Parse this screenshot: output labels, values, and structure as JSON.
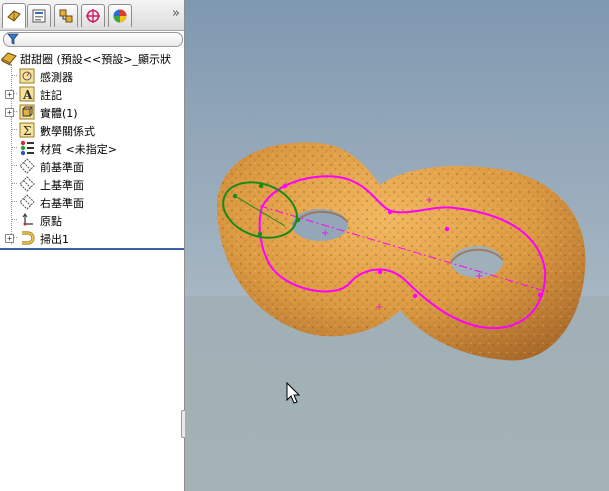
{
  "feature_tree": {
    "tabs": [
      "featuremanager-tab",
      "propertymanager-tab",
      "configurationmanager-tab",
      "dimxpert-tab",
      "display-tab"
    ],
    "more_symbol": "»",
    "filter_icon": "funnel-icon",
    "root": {
      "label": "甜甜圈 (預設<<預設>_顯示狀"
    },
    "items": [
      {
        "label": "感測器",
        "icon": "sensor-icon",
        "expandable": false
      },
      {
        "label": "註記",
        "icon": "annotations-icon",
        "expandable": true,
        "expander": "+"
      },
      {
        "label": "實體(1)",
        "icon": "solid-bodies-icon",
        "expandable": true,
        "expander": "+"
      },
      {
        "label": "數學關係式",
        "icon": "equations-icon",
        "expandable": false
      },
      {
        "label": "材質 <未指定>",
        "icon": "material-icon",
        "expandable": false
      },
      {
        "label": "前基準面",
        "icon": "plane-icon",
        "expandable": false
      },
      {
        "label": "上基準面",
        "icon": "plane-icon",
        "expandable": false
      },
      {
        "label": "右基準面",
        "icon": "plane-icon",
        "expandable": false
      },
      {
        "label": "原點",
        "icon": "origin-icon",
        "expandable": false
      },
      {
        "label": "掃出1",
        "icon": "sweep-icon",
        "expandable": true,
        "expander": "+"
      }
    ]
  },
  "colors": {
    "viewport_top": "#7e98b0",
    "viewport_bottom": "#a3b2b5",
    "donut": "#d9953f",
    "sweep_path": "#ff00ff",
    "profile": "#1a8a1a",
    "tree_separator": "#3b63a8"
  }
}
